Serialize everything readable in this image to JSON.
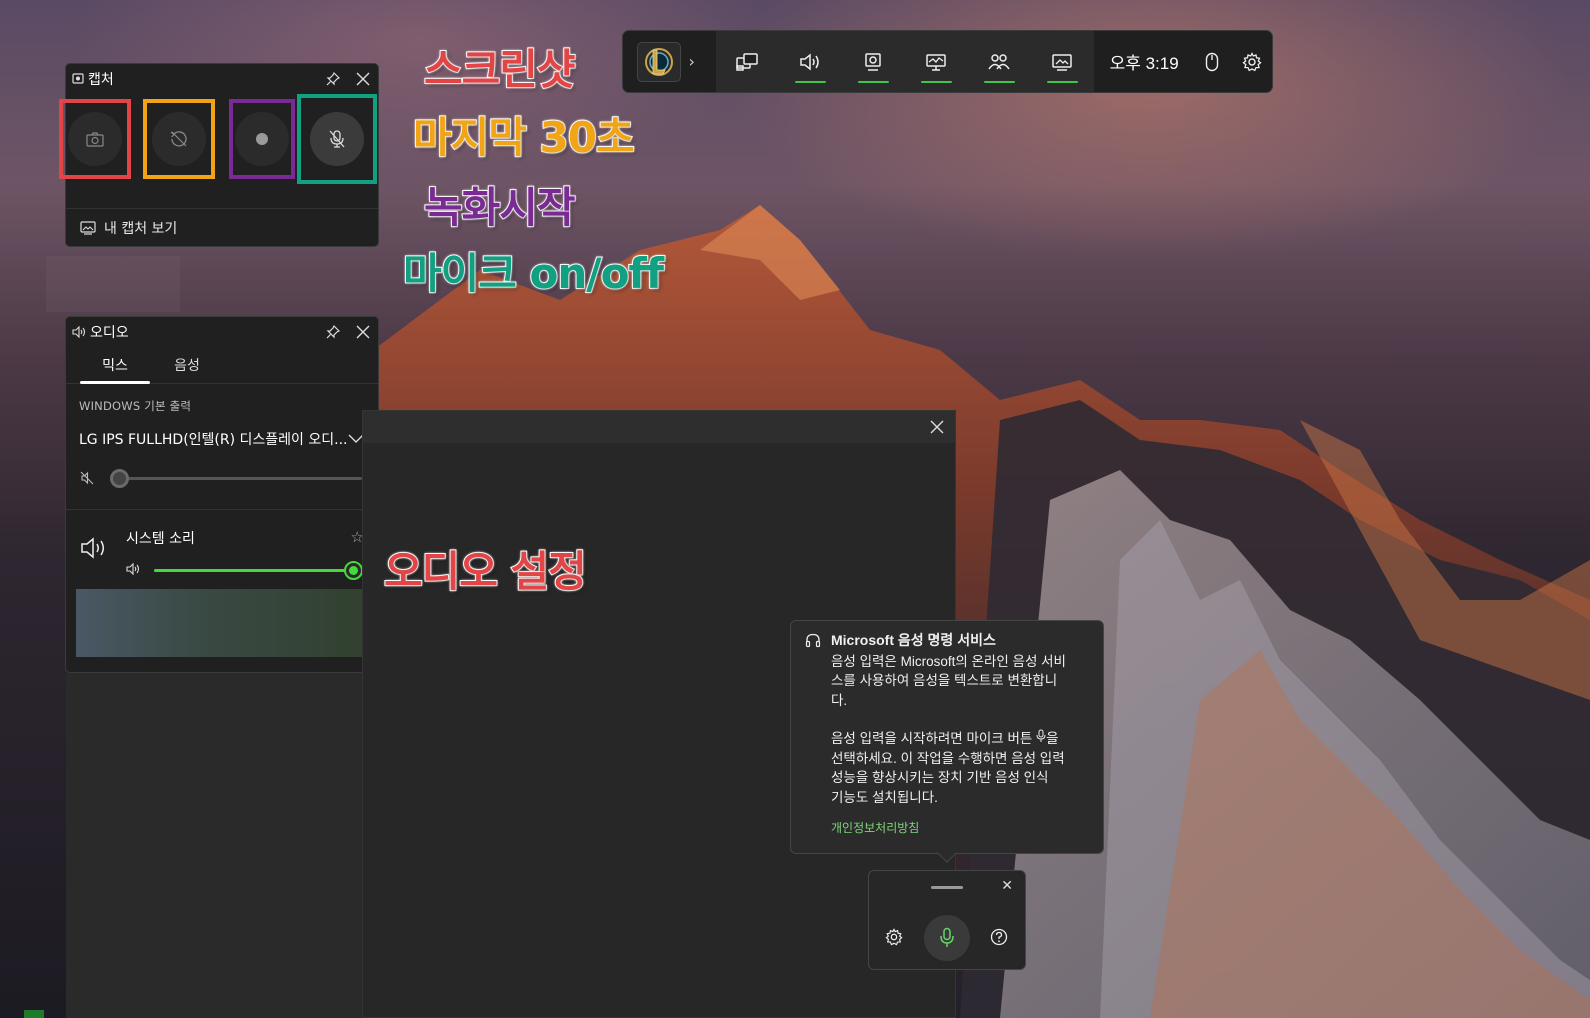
{
  "gamebar": {
    "time": "오후 3:19",
    "widgets": [
      "widget-menu-icon",
      "audio-icon",
      "capture-icon",
      "performance-icon",
      "social-icon",
      "gallery-icon"
    ],
    "accent": "#3fc64a"
  },
  "capture": {
    "title": "캡처",
    "footer": "내 캡처 보기",
    "buttons": [
      "screenshot",
      "record-last-30s",
      "start-recording",
      "mic-toggle"
    ]
  },
  "audio": {
    "title": "오디오",
    "tabs": [
      "믹스",
      "음성"
    ],
    "section_label": "WINDOWS 기본 출력",
    "device": "LG IPS FULLHD(인텔(R) 디스플레이 오디...",
    "device_volume": 0,
    "system_sound": "시스템 소리",
    "system_volume": 1.0
  },
  "annotations": {
    "screenshot": "스크린샷",
    "last30": "마지막 30초",
    "record": "녹화시작",
    "mic": "마이크 on/off",
    "audio_settings": "오디오 설정"
  },
  "annotation_colors": {
    "red": "#e34446",
    "orange": "#f1a415",
    "purple": "#7a2a93",
    "teal": "#11a182"
  },
  "voice_tip": {
    "title": "Microsoft 음성 명령 서비스",
    "line1": "음성 입력은 Microsoft의 온라인 음성 서비",
    "line2": "스를 사용하여 음성을 텍스트로 변환합니",
    "line3": "다.",
    "line4a": "음성 입력을 시작하려면 마이크 버튼",
    "line4b": "을",
    "line5": "선택하세요. 이 작업을 수행하면 음성 입력",
    "line6": "성능을 향상시키는 장치 기반 음성 인식",
    "line7": "기능도 설치됩니다.",
    "link": "개인정보처리방침"
  },
  "voicebar": {
    "close": "✕"
  }
}
